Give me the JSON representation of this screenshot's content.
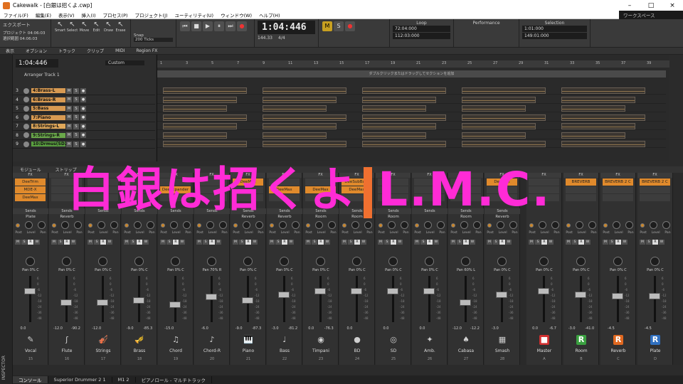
{
  "window": {
    "title": "Cakewalk - [白銀は招くよ.cwp]"
  },
  "menu": [
    "ファイル(F)",
    "編集(E)",
    "表示(V)",
    "挿入(I)",
    "プロセス(P)",
    "プロジェクト(J)",
    "ユーティリティ(U)",
    "ウィンドウ(W)",
    "ヘルプ(H)"
  ],
  "workspace": "ワークスペース",
  "control": {
    "export": "エクスポート",
    "project_time": "プロジェクト 04:06:03",
    "select_time": "選択範囲 04:06:03",
    "tools": [
      "Smart",
      "Select",
      "Move",
      "Edit",
      "Draw",
      "Erase"
    ],
    "snap": "Snap",
    "snap_val": "200 Ticks",
    "marks": "Marks",
    "time": "1:04:446",
    "tempo": "144.33",
    "meter": "4/4",
    "loop_label": "Loop",
    "loop_start": "72:04:000",
    "loop_end": "112:03:000",
    "perf_label": "Performance",
    "sel_label": "Selection",
    "sel_start": "1:01:000",
    "sel_end": "149:01:000"
  },
  "viewbar": [
    "表示",
    "オプション",
    "トラック",
    "クリップ",
    "MIDI",
    "Region FX"
  ],
  "trackpane": {
    "time": "1:04:446",
    "preset": "Custom",
    "arranger": "Arranger Track 1",
    "arranger_hint": "ダブルクリックまたはドラッグしてセクションを追加",
    "tracks": [
      {
        "num": "3",
        "name": "4:Brass-L",
        "color": "#d89a52"
      },
      {
        "num": "4",
        "name": "6:Brass-R",
        "color": "#d89a52"
      },
      {
        "num": "5",
        "name": "5:Bass",
        "color": "#d89a52"
      },
      {
        "num": "6",
        "name": "7:Piano",
        "color": "#d89a52"
      },
      {
        "num": "7",
        "name": "8:Strings-L",
        "color": "#e0a85a"
      },
      {
        "num": "8",
        "name": "9:Strings-R",
        "color": "#6aa84a"
      },
      {
        "num": "9",
        "name": "10:Drmus(SD2)",
        "color": "#5aa040"
      }
    ]
  },
  "ruler": [
    "1",
    "3",
    "5",
    "7",
    "9",
    "11",
    "13",
    "15",
    "17",
    "19",
    "21",
    "23",
    "25",
    "27",
    "29",
    "31",
    "33",
    "35",
    "37",
    "39"
  ],
  "console": {
    "tabs": [
      "モジュール",
      "ストリップ"
    ],
    "strips": [
      {
        "name": "Vocal",
        "num": "15",
        "fx": [
          "DeeTrim",
          "MDE-X",
          "DeeMax"
        ],
        "send": "Plate",
        "pan": "Pan 0% C",
        "v1": "0.0",
        "v2": "",
        "icon": "✎",
        "fader": 0.72
      },
      {
        "name": "Flute",
        "num": "16",
        "fx": [
          "",
          "",
          ""
        ],
        "send": "Reverb",
        "pan": "Pan 0% C",
        "v1": "-12.0",
        "v2": "-90.2",
        "icon": "ʃ",
        "fader": 0.45
      },
      {
        "name": "Strings",
        "num": "17",
        "fx": [
          "",
          "",
          ""
        ],
        "send": "",
        "pan": "Pan 0% C",
        "v1": "-12.0",
        "v2": "",
        "icon": "🎻",
        "fader": 0.45
      },
      {
        "name": "Brass",
        "num": "18",
        "fx": [
          "",
          "",
          ""
        ],
        "send": "",
        "pan": "Pan 0% C",
        "v1": "-9.0",
        "v2": "-85.3",
        "icon": "🎺",
        "fader": 0.5
      },
      {
        "name": "Chord",
        "num": "19",
        "fx": [
          "",
          "DeeExpander",
          ""
        ],
        "send": "",
        "pan": "Pan 0% C",
        "v1": "-15.0",
        "v2": "",
        "icon": "♫",
        "fader": 0.4
      },
      {
        "name": "Chord-R",
        "num": "20",
        "fx": [
          "",
          "",
          ""
        ],
        "send": "",
        "pan": "Pan 70% R",
        "v1": "-6.0",
        "v2": "",
        "icon": "♪",
        "fader": 0.58
      },
      {
        "name": "Piano",
        "num": "21",
        "fx": [
          "DeeMax",
          "",
          ""
        ],
        "send": "Reverb",
        "pan": "Pan 0% C",
        "v1": "-9.0",
        "v2": "-87.3",
        "icon": "🎹",
        "fader": 0.5
      },
      {
        "name": "Bass",
        "num": "22",
        "fx": [
          "",
          "DeeMax",
          ""
        ],
        "send": "Reverb",
        "pan": "Pan 0% C",
        "v1": "-3.0",
        "v2": "-81.2",
        "icon": "♩",
        "fader": 0.64
      },
      {
        "name": "Timpani",
        "num": "23",
        "fx": [
          "",
          "DeeMax",
          ""
        ],
        "send": "Room",
        "pan": "Pan 0% C",
        "v1": "0.0",
        "v2": "-76.3",
        "icon": "◉",
        "fader": 0.72
      },
      {
        "name": "BD",
        "num": "24",
        "fx": [
          "DeeSubBass",
          "DeeMax",
          ""
        ],
        "send": "Room",
        "pan": "Pan 0% C",
        "v1": "0.0",
        "v2": "",
        "icon": "●",
        "fader": 0.72
      },
      {
        "name": "SD",
        "num": "25",
        "fx": [
          "",
          "",
          ""
        ],
        "send": "Room",
        "pan": "Pan 0% C",
        "v1": "0.0",
        "v2": "",
        "icon": "◎",
        "fader": 0.72
      },
      {
        "name": "Amb.",
        "num": "26",
        "fx": [
          "",
          "",
          ""
        ],
        "send": "",
        "pan": "Pan 0% C",
        "v1": "0.0",
        "v2": "",
        "icon": "✦",
        "fader": 0.72
      },
      {
        "name": "Cabasa",
        "num": "27",
        "fx": [
          "",
          "",
          ""
        ],
        "send": "Room",
        "pan": "Pan 60% L",
        "v1": "-12.0",
        "v2": "-12.2",
        "icon": "♠",
        "fader": 0.45
      },
      {
        "name": "Smash",
        "num": "28",
        "fx": [
          "DeeMax",
          "",
          ""
        ],
        "send": "Reverb",
        "pan": "Pan 0% C",
        "v1": "-3.0",
        "v2": "",
        "icon": "▦",
        "fader": 0.64
      }
    ],
    "buses": [
      {
        "name": "Master",
        "num": "A",
        "fx": [
          "",
          "",
          ""
        ],
        "pan": "Pan 0% C",
        "v1": "0.0",
        "v2": "-6.7",
        "icon": "■",
        "icolor": "#d03030",
        "fader": 0.72
      },
      {
        "name": "Room",
        "num": "B",
        "fx": [
          "BREVERB",
          "",
          ""
        ],
        "pan": "Pan 0% C",
        "v1": "-3.0",
        "v2": "-41.0",
        "icon": "R",
        "icolor": "#3aa040",
        "fader": 0.64
      },
      {
        "name": "Reverb",
        "num": "C",
        "fx": [
          "BREVERB 2 C",
          "",
          ""
        ],
        "pan": "Pan 0% C",
        "v1": "-4.5",
        "v2": "",
        "icon": "R",
        "icolor": "#e06820",
        "fader": 0.6
      },
      {
        "name": "Plate",
        "num": "D",
        "fx": [
          "BREVERB 2 C",
          "",
          ""
        ],
        "pan": "Pan 0% C",
        "v1": "-4.5",
        "v2": "",
        "icon": "R",
        "icolor": "#3070c0",
        "fader": 0.6
      }
    ]
  },
  "overlay": {
    "text1": "白銀は招くよ",
    "text2": "L.M.C."
  },
  "bottom_tabs": [
    "コンソール",
    "Superior Drummer 2 1",
    "M1 2",
    "ピアノロール - マルチトラック"
  ],
  "inspector_label": "INSPECTOR"
}
